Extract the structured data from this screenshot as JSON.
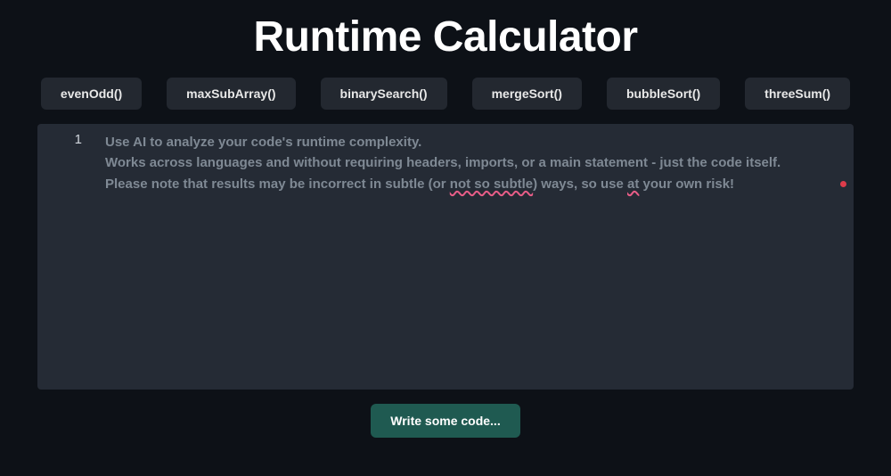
{
  "title": "Runtime Calculator",
  "presets": [
    "evenOdd()",
    "maxSubArray()",
    "binarySearch()",
    "mergeSort()",
    "bubbleSort()",
    "threeSum()"
  ],
  "editor": {
    "line_number": "1",
    "placeholder": {
      "line1": "Use AI to analyze your code's runtime complexity.",
      "line2": "Works across languages and without requiring headers, imports, or a main statement - just the code itself.",
      "line3_a": "Please note that results may be incorrect in subtle (or ",
      "line3_sq1": "not so subtle",
      "line3_b": ") ways, so use ",
      "line3_sq2": "at",
      "line3_c": " your own risk!"
    }
  },
  "action_button": "Write some code..."
}
